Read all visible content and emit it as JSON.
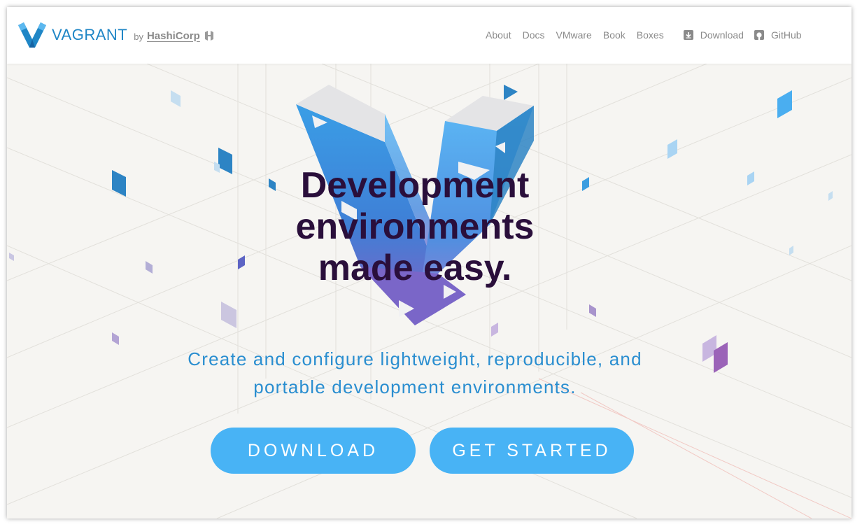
{
  "header": {
    "brand_name": "VAGRANT",
    "by": "by",
    "company": "HashiCorp",
    "nav": [
      "About",
      "Docs",
      "VMware",
      "Book",
      "Boxes"
    ],
    "download_link": "Download",
    "github_link": "GitHub"
  },
  "hero": {
    "headline": [
      "Development",
      "environments",
      "made easy."
    ],
    "subline": [
      "Create and configure lightweight, reproducible, and",
      "portable development environments."
    ],
    "download_button": "DOWNLOAD",
    "get_started_button": "GET STARTED"
  },
  "colors": {
    "brand_blue": "#1f86c6",
    "button_blue": "#48b3f5",
    "headline_purple": "#2a0f3b",
    "background": "#f6f5f2"
  }
}
